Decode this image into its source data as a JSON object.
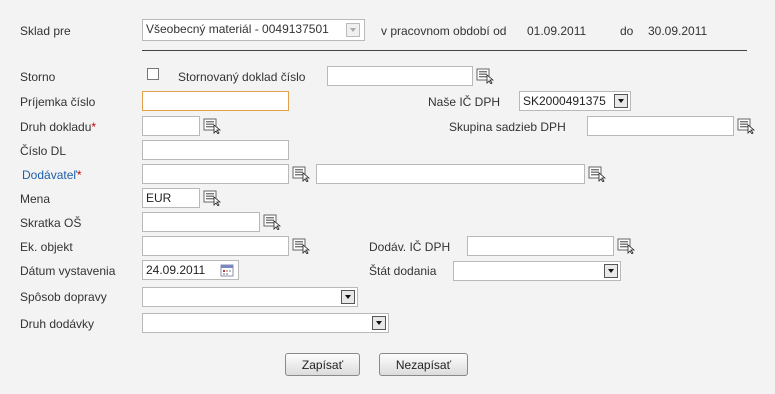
{
  "header": {
    "warehouse_label": "Sklad pre",
    "warehouse_value": "Všeobecný materiál - 0049137501",
    "period_label": "v pracovnom období od",
    "period_from": "01.09.2011",
    "period_to_label": "do",
    "period_to": "30.09.2011"
  },
  "form": {
    "storno_label": "Storno",
    "storno_checked": false,
    "storno_doc_label": "Stornovaný doklad číslo",
    "storno_doc_value": "",
    "receipt_no_label": "Príjemka číslo",
    "receipt_no_value": "",
    "our_vat_label": "Naše IČ DPH",
    "our_vat_value": "SK2000491375",
    "doc_type_label": "Druh dokladu",
    "doc_type_value": "",
    "vat_group_label": "Skupina sadzieb DPH",
    "vat_group_value": "",
    "dl_no_label": "Číslo DL",
    "dl_no_value": "",
    "supplier_label": "Dodávateľ",
    "supplier_code": "",
    "supplier_name": "",
    "currency_label": "Mena",
    "currency_value": "EUR",
    "os_abbr_label": "Skratka OŠ",
    "os_abbr_value": "",
    "econ_object_label": "Ek. objekt",
    "econ_object_value": "",
    "supplier_vat_label": "Dodáv. IČ DPH",
    "supplier_vat_value": "",
    "issue_date_label": "Dátum vystavenia",
    "issue_date_value": "24.09.2011",
    "delivery_state_label": "Štát dodania",
    "delivery_state_value": "",
    "transport_label": "Spôsob dopravy",
    "transport_value": "",
    "delivery_type_label": "Druh dodávky",
    "delivery_type_value": "",
    "required_mark": "*"
  },
  "buttons": {
    "save": "Zapísať",
    "cancel": "Nezapísať"
  },
  "colors": {
    "link": "#1f5fa8",
    "required": "#cc0000",
    "focus_border": "#e2a24d"
  },
  "icons": {
    "lookup": "lookup-list-icon",
    "calendar": "calendar-icon",
    "dropdown": "chevron-down-icon"
  }
}
